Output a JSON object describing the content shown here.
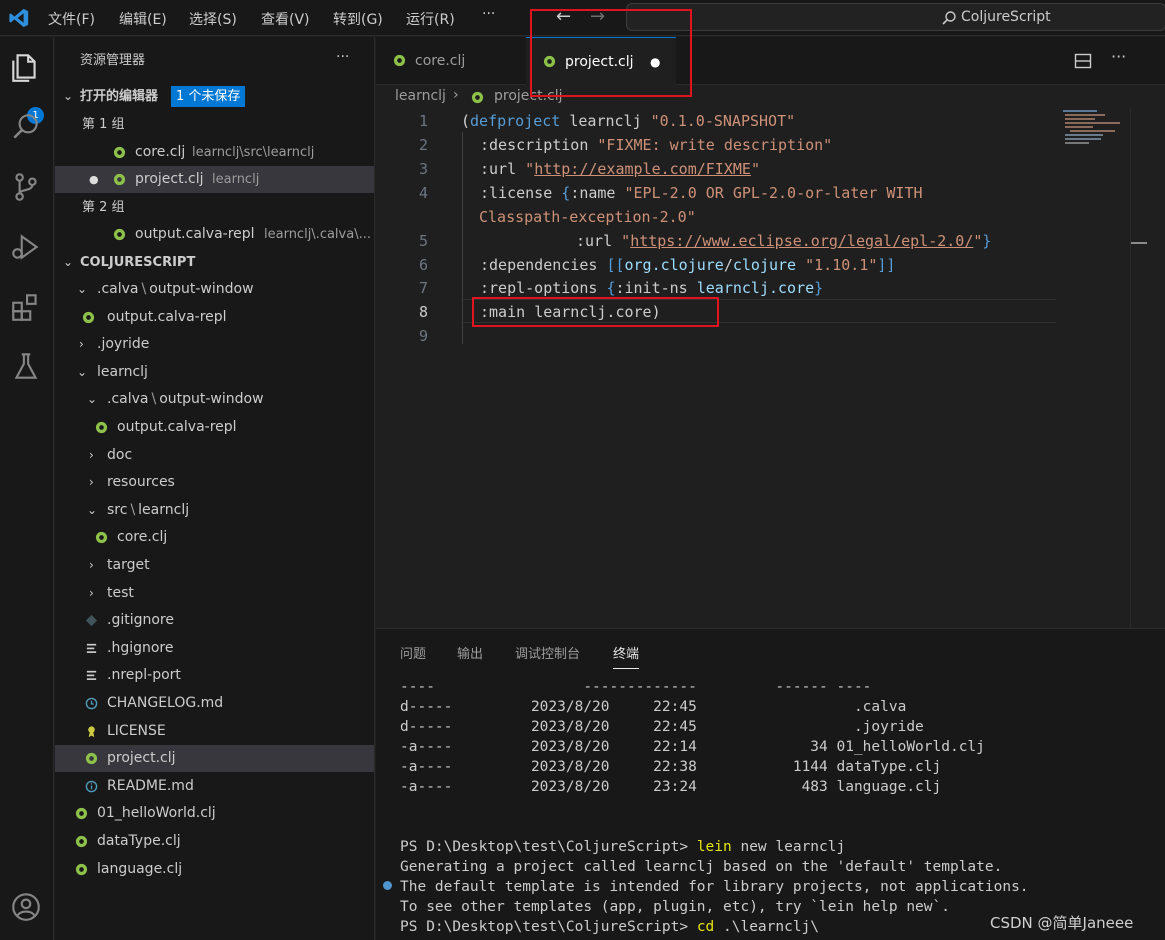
{
  "menu": [
    "文件(F)",
    "编辑(E)",
    "选择(S)",
    "查看(V)",
    "转到(G)",
    "运行(R)",
    "···"
  ],
  "command_center": "ColjureScript",
  "activity": {
    "badge": "1"
  },
  "explorer": {
    "title": "资源管理器",
    "more": "···",
    "open_editors": {
      "label": "打开的编辑器",
      "badge": "1 个未保存",
      "group1": "第 1 组",
      "g1": [
        {
          "name": "core.clj",
          "path": "learnclj\\src\\learnclj"
        },
        {
          "name": "project.clj",
          "path": "learnclj"
        }
      ],
      "group2": "第 2 组",
      "g2": [
        {
          "name": "output.calva-repl",
          "path": "learnclj\\.calva\\..."
        }
      ]
    },
    "root": "COLJURESCRIPT",
    "tree": [
      {
        "label": ".calva",
        "sep": "\\",
        "label2": "output-window"
      },
      {
        "label": "output.calva-repl"
      },
      {
        "label": ".joyride"
      },
      {
        "label": "learnclj"
      },
      {
        "label": ".calva",
        "sep": "\\",
        "label2": "output-window"
      },
      {
        "label": "output.calva-repl"
      },
      {
        "label": "doc"
      },
      {
        "label": "resources"
      },
      {
        "label": "src",
        "sep": "\\",
        "label2": "learnclj"
      },
      {
        "label": "core.clj"
      },
      {
        "label": "target"
      },
      {
        "label": "test"
      },
      {
        "label": ".gitignore"
      },
      {
        "label": ".hgignore"
      },
      {
        "label": ".nrepl-port"
      },
      {
        "label": "CHANGELOG.md"
      },
      {
        "label": "LICENSE"
      },
      {
        "label": "project.clj"
      },
      {
        "label": "README.md"
      },
      {
        "label": "01_helloWorld.clj"
      },
      {
        "label": "dataType.clj"
      },
      {
        "label": "language.clj"
      }
    ]
  },
  "tabs": [
    {
      "label": "core.clj"
    },
    {
      "label": "project.clj",
      "dirty": "●"
    }
  ],
  "breadcrumb": {
    "folder": "learnclj",
    "sep": "›",
    "file": "project.clj"
  },
  "code": {
    "l1": {
      "a": "(",
      "b": "defproject",
      "c": " learnclj ",
      "d": "\"0.1.0-SNAPSHOT\""
    },
    "l2": {
      "a": ":description ",
      "b": "\"FIXME: write description\""
    },
    "l3": {
      "a": ":url ",
      "b": "\"",
      "c": "http://example.com/FIXME",
      "d": "\""
    },
    "l4": {
      "a": ":license ",
      "b": "{",
      "c": ":name ",
      "d": "\"EPL-2.0 OR GPL-2.0-or-later WITH"
    },
    "l4w": "Classpath-exception-2.0\"",
    "l5": {
      "a": ":url ",
      "b": "\"",
      "c": "https://www.eclipse.org/legal/epl-2.0/",
      "d": "\"",
      "e": "}"
    },
    "l6": {
      "a": ":dependencies ",
      "b": "[[",
      "c": "org.clojure",
      "d": "/",
      "e": "clojure",
      "f": " \"1.10.1\"",
      "g": "]]"
    },
    "l7": {
      "a": ":repl-options ",
      "b": "{",
      "c": ":init-ns ",
      "d": "learnclj.core",
      "e": "}"
    },
    "l8": {
      "a": ":main ",
      "b": "learnclj.core",
      "c": ")"
    },
    "line_numbers": [
      "1",
      "2",
      "3",
      "4",
      "5",
      "6",
      "7",
      "8",
      "9"
    ]
  },
  "panel": {
    "tabs": [
      "问题",
      "输出",
      "调试控制台",
      "终端"
    ],
    "active": "终端"
  },
  "terminal": {
    "head": "----                 -------------         ------ ----",
    "rows": [
      "d-----         2023/8/20     22:45                  .calva",
      "d-----         2023/8/20     22:45                  .joyride",
      "-a----         2023/8/20     22:14             34 01_helloWorld.clj",
      "-a----         2023/8/20     22:38           1144 dataType.clj",
      "-a----         2023/8/20     23:24            483 language.clj"
    ],
    "blank": " ",
    "cmd1_prompt": "PS D:\\Desktop\\test\\ColjureScript> ",
    "cmd1_lein": "lein",
    "cmd1_rest": " new learnclj",
    "out1": "Generating a project called learnclj based on the 'default' template.",
    "out2": "The default template is intended for library projects, not applications.",
    "out3": "To see other templates (app, plugin, etc), try `lein help new`.",
    "cmd2_prompt": "PS D:\\Desktop\\test\\ColjureScript> ",
    "cmd2_cd": "cd",
    "cmd2_rest": " .\\learnclj\\"
  },
  "watermark": "CSDN @简单Janeee"
}
